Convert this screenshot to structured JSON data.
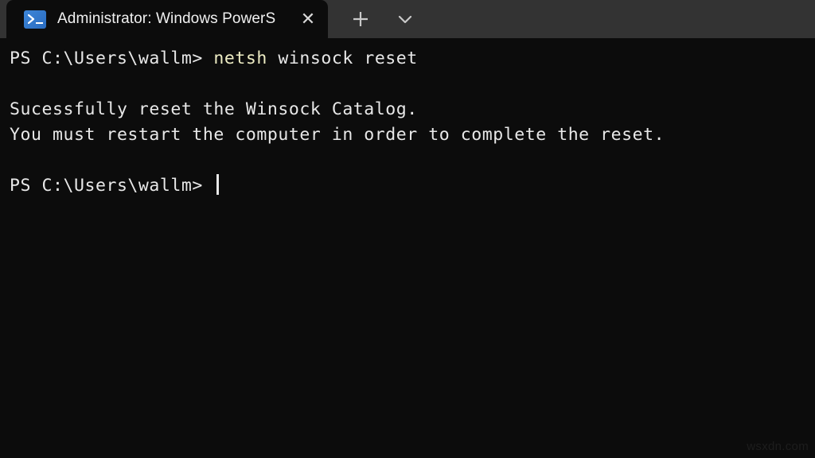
{
  "window": {
    "tab": {
      "icon": "powershell-icon",
      "title": "Administrator: Windows PowerS",
      "close_label": "✕"
    },
    "new_tab_label": "+",
    "dropdown_label": "⌄",
    "colors": {
      "tabstrip_bg": "#333333",
      "terminal_bg": "#0c0c0c",
      "icon_blue": "#3d86d8",
      "command_yellow": "#eeedc4",
      "text_white": "#e6e6e6"
    }
  },
  "terminal": {
    "lines": [
      {
        "id": "command-line",
        "segments": [
          {
            "text": "PS C:\\Users\\wallm> ",
            "style": "plain"
          },
          {
            "text": "netsh",
            "style": "cmd"
          },
          {
            "text": " winsock reset",
            "style": "plain"
          }
        ]
      },
      {
        "id": "blank-line-1",
        "segments": [
          {
            "text": " ",
            "style": "plain"
          }
        ]
      },
      {
        "id": "output-line-1",
        "segments": [
          {
            "text": "Sucessfully reset the Winsock Catalog.",
            "style": "plain"
          }
        ]
      },
      {
        "id": "output-line-2",
        "segments": [
          {
            "text": "You must restart the computer in order to complete the reset.",
            "style": "plain"
          }
        ]
      },
      {
        "id": "blank-line-2",
        "segments": [
          {
            "text": " ",
            "style": "plain"
          }
        ]
      },
      {
        "id": "prompt-line",
        "segments": [
          {
            "text": "PS C:\\Users\\wallm> ",
            "style": "plain"
          }
        ],
        "cursor": true
      }
    ]
  },
  "watermark": {
    "text": "wsxdn.com"
  }
}
